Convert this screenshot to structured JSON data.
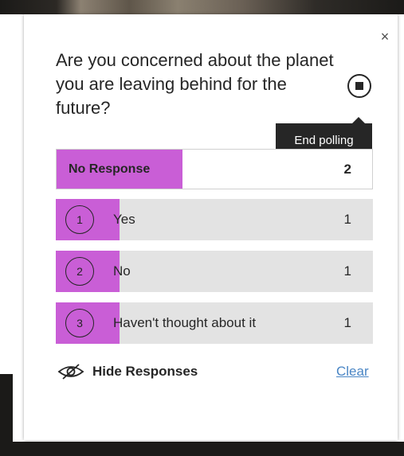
{
  "poll": {
    "question": "Are you concerned about the planet you are leaving behind for the future?",
    "close_icon": "×",
    "end_polling_tooltip": "End polling",
    "no_response": {
      "label": "No Response",
      "count": "2",
      "fill_fraction": 0.4
    },
    "options": [
      {
        "number": "1",
        "label": "Yes",
        "count": "1",
        "fill_fraction": 0.2
      },
      {
        "number": "2",
        "label": "No",
        "count": "1",
        "fill_fraction": 0.2
      },
      {
        "number": "3",
        "label": "Haven't thought about it",
        "count": "1",
        "fill_fraction": 0.2
      }
    ],
    "hide_responses_label": "Hide Responses",
    "clear_label": "Clear"
  },
  "colors": {
    "accent": "#c95ed6",
    "bar_background": "#e3e3e3",
    "link": "#4a86c5",
    "tooltip_background": "#262626"
  },
  "icons": {
    "close": "close-icon",
    "stop": "stop-circle-icon",
    "hide": "eye-slash-icon"
  }
}
